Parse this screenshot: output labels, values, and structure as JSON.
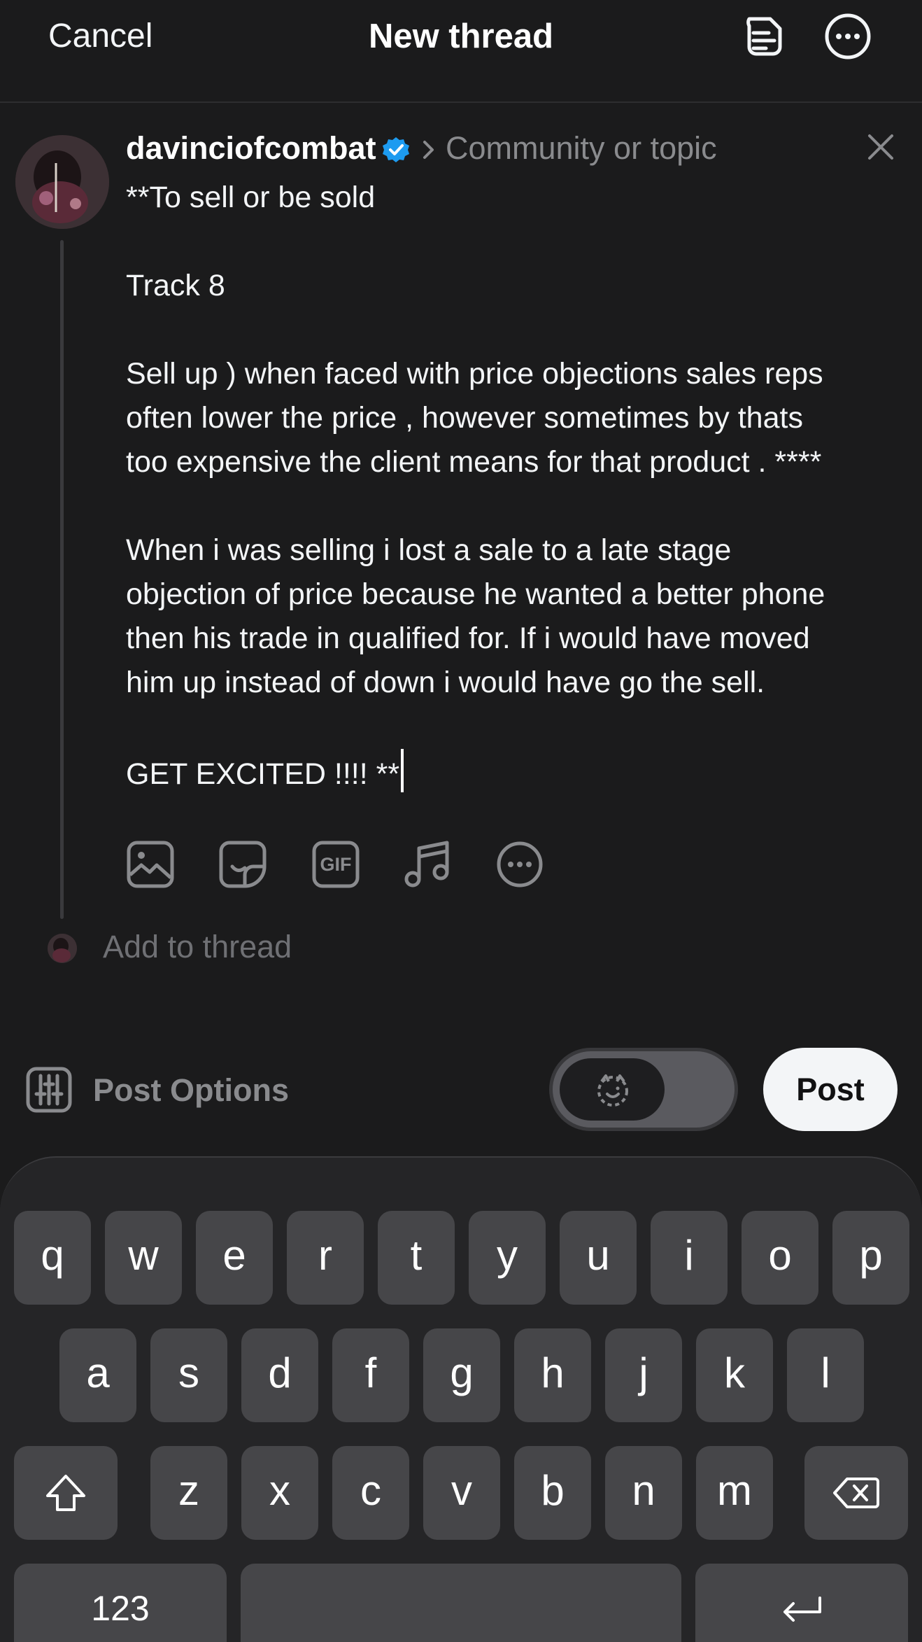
{
  "header": {
    "cancel_label": "Cancel",
    "title": "New thread",
    "icons": [
      "drafts-icon",
      "more-icon"
    ]
  },
  "composer": {
    "username": "davinciofcombat",
    "verified": true,
    "topic_placeholder": "Community or topic",
    "lines": [
      "**To sell or be sold",
      "",
      "Track 8",
      "",
      "Sell up ) when faced with price objections sales reps",
      "often lower the price , however sometimes by thats",
      "too expensive the client means for that product . ****",
      "",
      "When i was selling i lost a sale to a late stage",
      "objection of price because he wanted a better phone",
      "then his trade in qualified for. If i would have moved",
      "him up instead of down i would have go the sell.",
      "",
      "GET EXCITED !!!! **"
    ],
    "attachment_icons": [
      "image-icon",
      "sticker-icon",
      "gif-icon",
      "music-icon",
      "more-options-icon"
    ],
    "gif_label": "GIF",
    "add_to_thread": "Add to thread"
  },
  "footer": {
    "post_options_label": "Post Options",
    "post_label": "Post"
  },
  "keyboard": {
    "row1": [
      "q",
      "w",
      "e",
      "r",
      "t",
      "y",
      "u",
      "i",
      "o",
      "p"
    ],
    "row2": [
      "a",
      "s",
      "d",
      "f",
      "g",
      "h",
      "j",
      "k",
      "l"
    ],
    "row3": [
      "z",
      "x",
      "c",
      "v",
      "b",
      "n",
      "m"
    ],
    "numbers_label": "123",
    "accent_color": "#1d9bf0"
  }
}
